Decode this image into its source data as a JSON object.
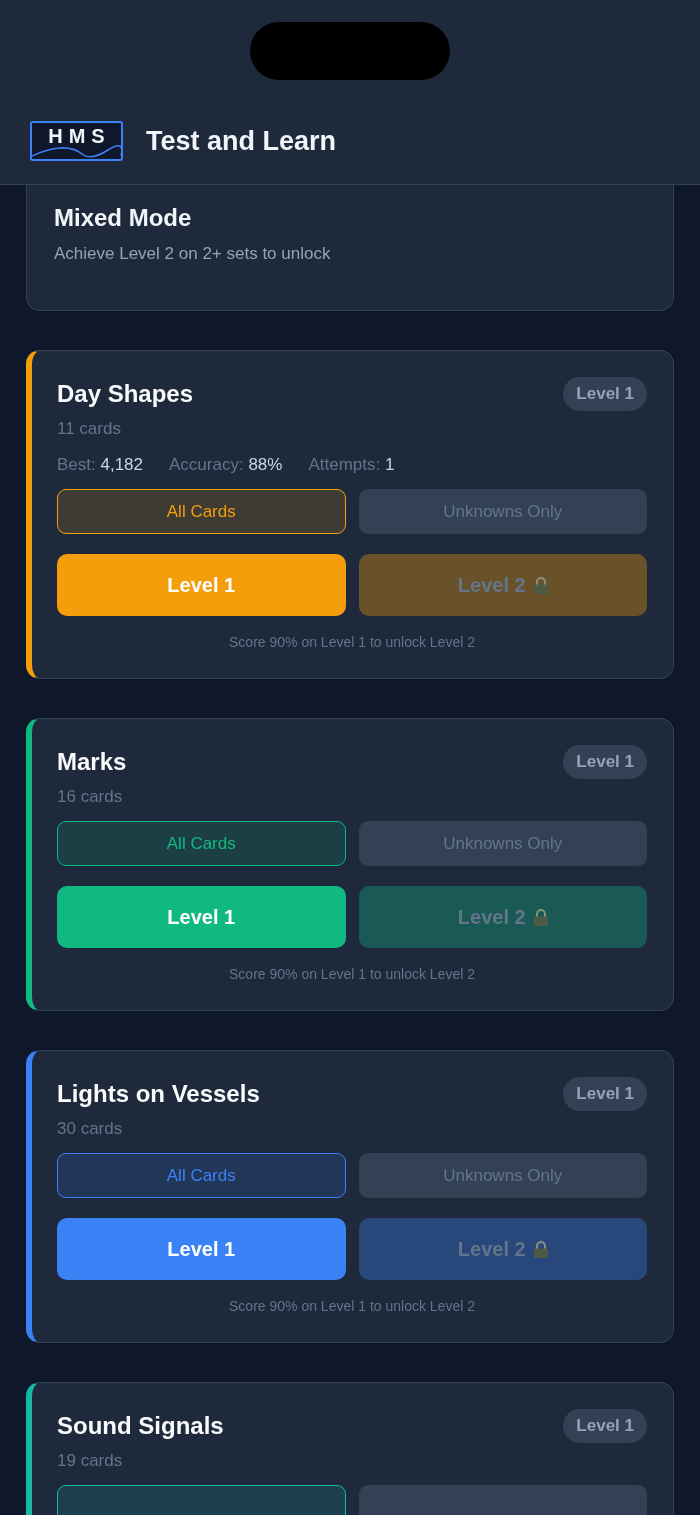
{
  "header": {
    "logo": "HMS",
    "title": "Test and Learn"
  },
  "mixed_mode": {
    "title": "Mixed Mode",
    "subtitle": "Achieve Level 2 on 2+ sets to unlock"
  },
  "sets": [
    {
      "title": "Day Shapes",
      "color": "#f59e0b",
      "badge": "Level 1",
      "count": "11 cards",
      "stats": [
        {
          "label": "Best:",
          "value": "4,182"
        },
        {
          "label": "Accuracy:",
          "value": "88%"
        },
        {
          "label": "Attempts:",
          "value": "1"
        }
      ],
      "modes": [
        {
          "label": "All Cards",
          "selected": true
        },
        {
          "label": "Unknowns Only",
          "selected": false
        }
      ],
      "levels": [
        {
          "label": "Level 1",
          "locked": false
        },
        {
          "label": "Level 2",
          "locked": true
        }
      ],
      "hint": "Score 90% on Level 1 to unlock Level 2"
    },
    {
      "title": "Marks",
      "color": "#10b981",
      "badge": "Level 1",
      "count": "16 cards",
      "modes": [
        {
          "label": "All Cards",
          "selected": true
        },
        {
          "label": "Unknowns Only",
          "selected": false
        }
      ],
      "levels": [
        {
          "label": "Level 1",
          "locked": false
        },
        {
          "label": "Level 2",
          "locked": true
        }
      ],
      "hint": "Score 90% on Level 1 to unlock Level 2"
    },
    {
      "title": "Lights on Vessels",
      "color": "#3b82f6",
      "badge": "Level 1",
      "count": "30 cards",
      "modes": [
        {
          "label": "All Cards",
          "selected": true
        },
        {
          "label": "Unknowns Only",
          "selected": false
        }
      ],
      "levels": [
        {
          "label": "Level 1",
          "locked": false
        },
        {
          "label": "Level 2",
          "locked": true
        }
      ],
      "hint": "Score 90% on Level 1 to unlock Level 2"
    },
    {
      "title": "Sound Signals",
      "color": "#14b8a6",
      "badge": "Level 1",
      "count": "19 cards",
      "modes": [
        {
          "selected": true
        },
        {
          "selected": false
        }
      ]
    }
  ]
}
